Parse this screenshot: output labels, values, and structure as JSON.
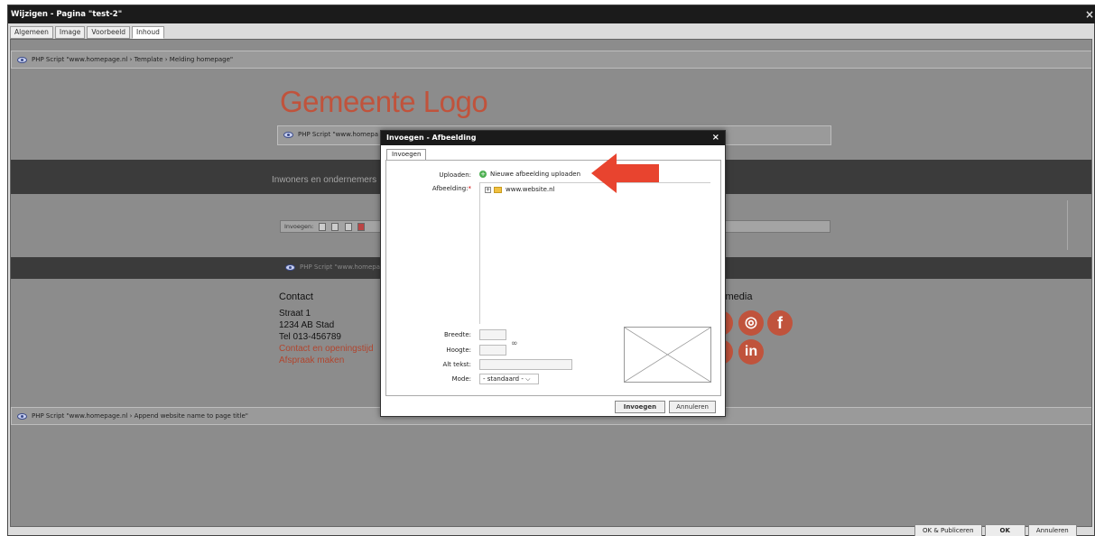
{
  "window": {
    "title": "Wijzigen - Pagina \"test-2\"",
    "close_glyph": "×"
  },
  "tabs": [
    {
      "label": "Algemeen"
    },
    {
      "label": "Image"
    },
    {
      "label": "Voorbeeld"
    },
    {
      "label": "Inhoud"
    }
  ],
  "page": {
    "script_top": "PHP Script \"www.homepage.nl › Template › Melding homepage\"",
    "logo_text": "Gemeente Logo",
    "script_mid": "PHP Script \"www.homepa",
    "nav_text": "Inwoners en ondernemers",
    "toolbar_label": "Invoegen:",
    "script_lower": "PHP Script \"www.homepa",
    "contact": {
      "title": "Contact",
      "street": "Straat 1",
      "city": "1234 AB  Stad",
      "phone": "Tel 013-456789",
      "link1": "Contact en openingstijd",
      "link2": "Afspraak maken"
    },
    "social_title": "l media",
    "social_icons": {
      "instagram": "◎",
      "facebook": "f",
      "linkedin": "in"
    },
    "script_bottom": "PHP Script \"www.homepage.nl › Append website name to page title\""
  },
  "footer": {
    "publish_label": "OK & Publiceren",
    "ok_label": "OK",
    "cancel_label": "Annuleren"
  },
  "dialog": {
    "title": "Invoegen - Afbeelding",
    "close_glyph": "×",
    "tab_label": "Invoegen",
    "upload_label": "Uploaden:",
    "upload_link": "Nieuwe afbeelding uploaden",
    "image_label": "Afbeelding:",
    "required_mark": "*",
    "tree_root": "www.website.nl",
    "tree_toggle": "+",
    "width_label": "Breedte:",
    "height_label": "Hoogte:",
    "alt_label": "Alt tekst:",
    "mode_label": "Mode:",
    "mode_value": "- standaard -",
    "insert_button": "Invoegen",
    "cancel_button": "Annuleren"
  },
  "colors": {
    "accent": "#c0533c",
    "arrow": "#e8442f",
    "dialog_header": "#1a1a1a"
  }
}
